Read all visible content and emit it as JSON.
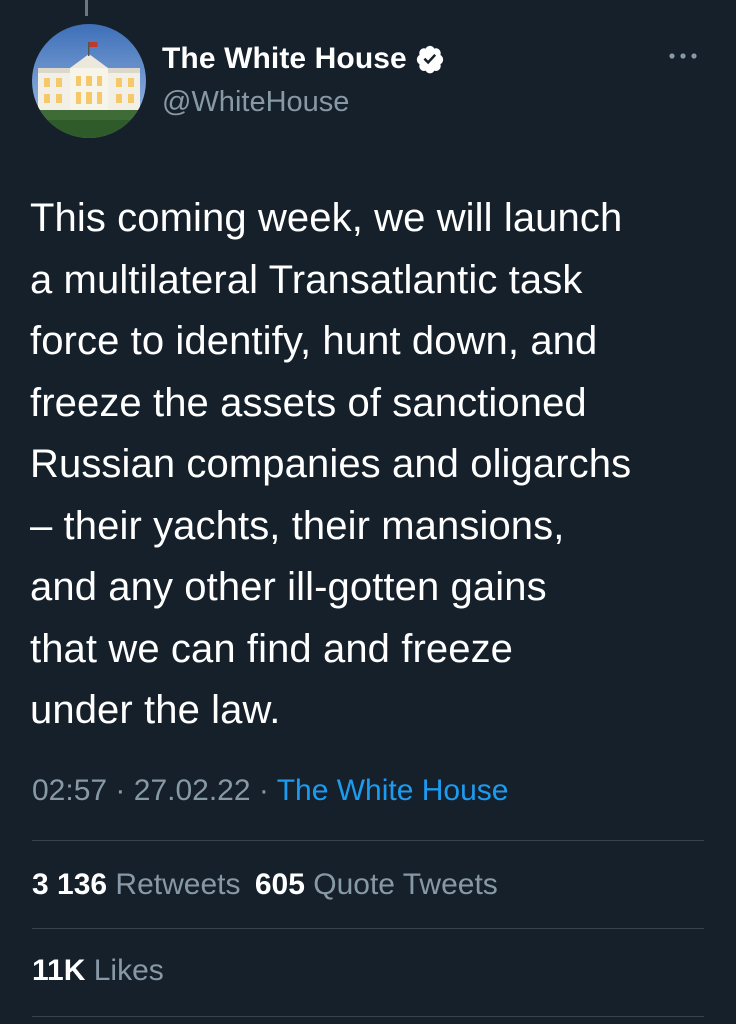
{
  "tweet": {
    "author": {
      "display_name": "The White House",
      "handle": "@WhiteHouse",
      "verified": true,
      "verified_icon": "verified-badge-icon",
      "avatar_icon": "white-house-avatar"
    },
    "more_icon": "more-options-icon",
    "text": "This coming week, we will launch\na multilateral Transatlantic task\nforce to identify, hunt down, and\nfreeze the assets of sanctioned\nRussian companies and oligarchs\n– their yachts, their mansions,\nand any other ill-gotten gains\nthat we can find and freeze\nunder the law.",
    "time": "02:57",
    "separator": "·",
    "date": "27.02.22",
    "source": "The White House"
  },
  "stats": {
    "retweets_count": "3 136",
    "retweets_label": "Retweets",
    "quotes_count": "605",
    "quotes_label": "Quote Tweets",
    "likes_count": "11K",
    "likes_label": "Likes"
  },
  "colors": {
    "background": "#15202b",
    "primary_text": "#ffffff",
    "secondary_text": "#8899a6",
    "link": "#1d9bf0",
    "divider": "#38444d"
  }
}
